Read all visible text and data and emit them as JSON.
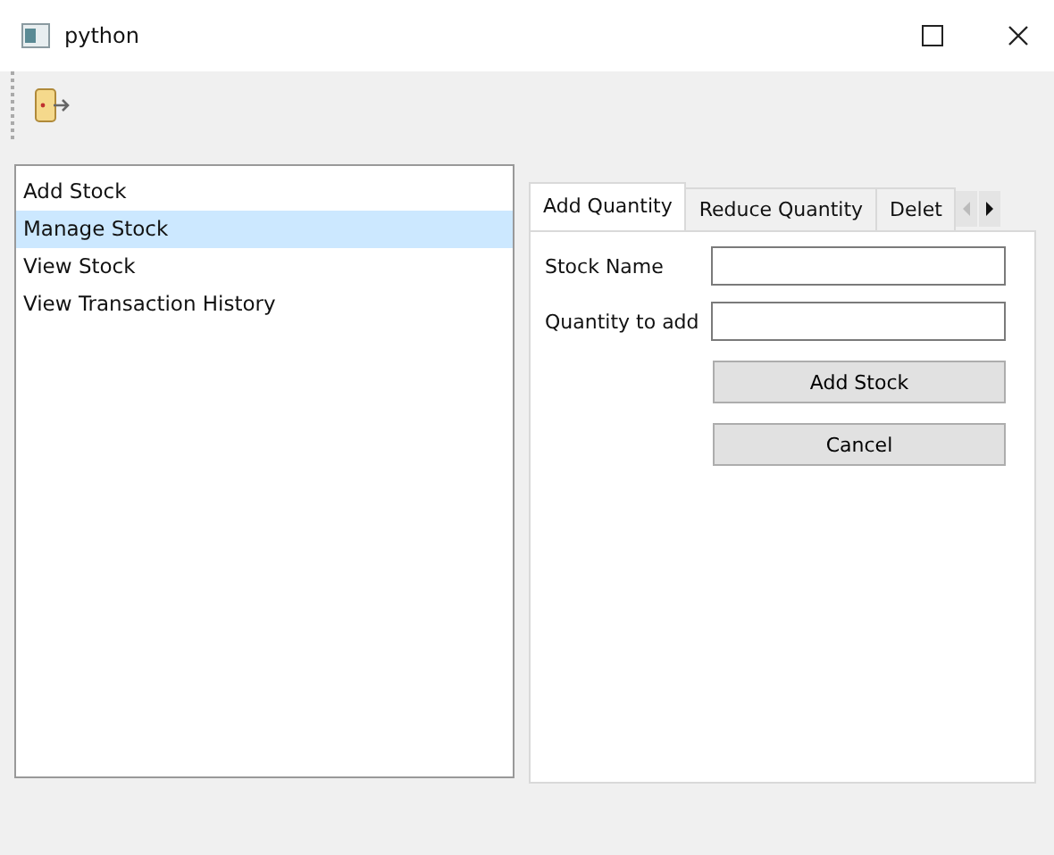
{
  "window": {
    "title": "python"
  },
  "sidebar": {
    "items": [
      {
        "label": "Add Stock",
        "selected": false
      },
      {
        "label": "Manage Stock",
        "selected": true
      },
      {
        "label": "View Stock",
        "selected": false
      },
      {
        "label": "View Transaction History",
        "selected": false
      }
    ]
  },
  "tabs": [
    {
      "label": "Add Quantity",
      "selected": true
    },
    {
      "label": "Reduce Quantity",
      "selected": false
    },
    {
      "label": "Delet",
      "selected": false
    }
  ],
  "form": {
    "fields": [
      {
        "label": "Stock Name"
      },
      {
        "label": "Quantity to add"
      }
    ],
    "buttons": [
      "Add Stock",
      "Cancel"
    ]
  }
}
